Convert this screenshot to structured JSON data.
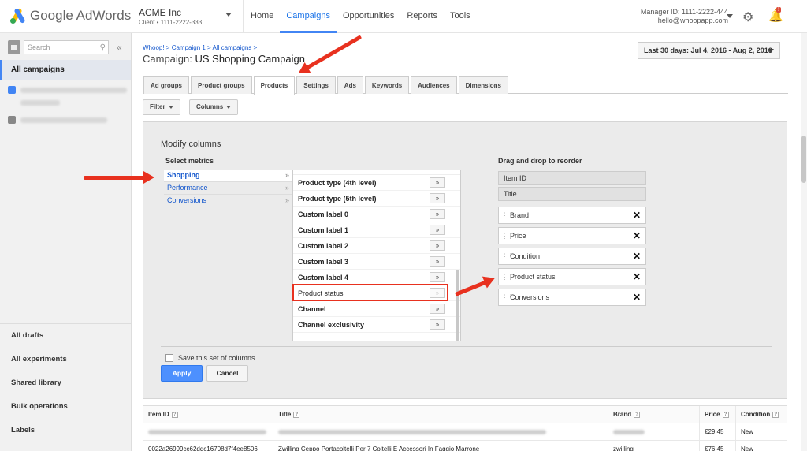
{
  "app": {
    "logo_text": "Google AdWords"
  },
  "account": {
    "name": "ACME Inc",
    "sub": "Client  •  1111-2222-333"
  },
  "nav": [
    {
      "label": "Home",
      "active": false
    },
    {
      "label": "Campaigns",
      "active": true
    },
    {
      "label": "Opportunities",
      "active": false
    },
    {
      "label": "Reports",
      "active": false
    },
    {
      "label": "Tools",
      "active": false
    }
  ],
  "manager": {
    "id": "Manager ID: 1111-2222-444",
    "email": "hello@whoopapp.com"
  },
  "notifications": {
    "badge": "!"
  },
  "sidebar": {
    "search_placeholder": "Search",
    "collapse": "«",
    "all_campaigns": "All campaigns",
    "bottom_links": [
      "All drafts",
      "All experiments",
      "Shared library",
      "Bulk operations",
      "Labels"
    ]
  },
  "header": {
    "breadcrumb": "Whoop! > Campaign 1 > All campaigns >",
    "title_label": "Campaign:",
    "title": "US Shopping Campaign",
    "date_range": "Last 30 days: Jul 4, 2016 - Aug 2, 2016"
  },
  "tabs": [
    "Ad groups",
    "Product groups",
    "Products",
    "Settings",
    "Ads",
    "Keywords",
    "Audiences",
    "Dimensions"
  ],
  "active_tab": "Products",
  "toolbar": {
    "filter": "Filter",
    "columns": "Columns"
  },
  "modify": {
    "title": "Modify columns",
    "select_metrics": "Select metrics",
    "categories": [
      {
        "label": "Shopping",
        "active": true
      },
      {
        "label": "Performance",
        "active": false
      },
      {
        "label": "Conversions",
        "active": false
      }
    ],
    "chevron": "»",
    "metrics": [
      {
        "label": "Product type (4th level)",
        "added": false
      },
      {
        "label": "Product type (5th level)",
        "added": false
      },
      {
        "label": "Custom label 0",
        "added": false
      },
      {
        "label": "Custom label 1",
        "added": false
      },
      {
        "label": "Custom label 2",
        "added": false
      },
      {
        "label": "Custom label 3",
        "added": false
      },
      {
        "label": "Custom label 4",
        "added": false
      },
      {
        "label": "Product status",
        "added": true
      },
      {
        "label": "Channel",
        "added": false
      },
      {
        "label": "Channel exclusivity",
        "added": false
      }
    ],
    "reorder_title": "Drag and drop to reorder",
    "fixed_columns": [
      "Item ID",
      "Title"
    ],
    "selected_columns": [
      "Brand",
      "Price",
      "Condition",
      "Product status",
      "Conversions"
    ],
    "save_label": "Save this set of columns",
    "apply": "Apply",
    "cancel": "Cancel"
  },
  "table": {
    "headers": [
      "Item ID",
      "Title",
      "Brand",
      "Price",
      "Condition"
    ],
    "rows": [
      {
        "item_id": "",
        "title": "",
        "brand": "",
        "price": "€29.45",
        "condition": "New"
      },
      {
        "item_id": "0022a26999cc62ddc16708d7f4ee8506",
        "title": "Zwilling Ceppo Portacoltelli Per 7 Coltelli E Accessori In Faggio Marrone",
        "brand": "zwilling",
        "price": "€76.45",
        "condition": "New"
      }
    ]
  },
  "colors": {
    "accent": "#4285f4",
    "annotation": "#e8311f",
    "apply": "#4d90fe"
  }
}
